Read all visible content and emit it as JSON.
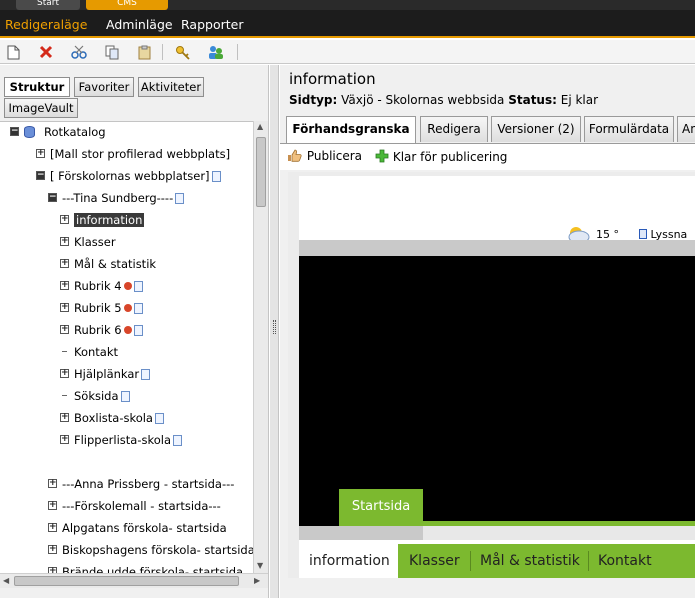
{
  "top_tabs": [
    "Start",
    "CMS"
  ],
  "modes": {
    "edit": "Redigeraläge",
    "admin": "Adminläge",
    "reports": "Rapporter"
  },
  "toolbar_icons": [
    "new-page-icon",
    "delete-icon",
    "cut-icon",
    "copy-icon",
    "paste-icon",
    "key-icon",
    "users-icon"
  ],
  "left_tabs": {
    "struktur": "Struktur",
    "favoriter": "Favoriter",
    "aktiviteter": "Aktiviteter",
    "imagevault": "ImageVault"
  },
  "tree": [
    {
      "label": "Rotkatalog",
      "level": 0,
      "state": "open",
      "icon": "database"
    },
    {
      "label": "[Mall stor profilerad webbplats]",
      "level": 1,
      "state": "closed"
    },
    {
      "label": "[ Förskolornas webbplatser]",
      "level": 1,
      "state": "open",
      "page": true
    },
    {
      "label": "---Tina Sundberg----",
      "level": 2,
      "state": "open",
      "page": true
    },
    {
      "label": "information",
      "level": 3,
      "state": "closed",
      "selected": true
    },
    {
      "label": "Klasser",
      "level": 3,
      "state": "closed"
    },
    {
      "label": "Mål & statistik",
      "level": 3,
      "state": "closed"
    },
    {
      "label": "Rubrik 4",
      "level": 3,
      "state": "closed",
      "lock": true,
      "page": true
    },
    {
      "label": "Rubrik 5",
      "level": 3,
      "state": "closed",
      "lock": true,
      "page": true
    },
    {
      "label": "Rubrik 6",
      "level": 3,
      "state": "closed",
      "lock": true,
      "page": true
    },
    {
      "label": "Kontakt",
      "level": 3,
      "state": "leaf"
    },
    {
      "label": "Hjälplänkar",
      "level": 3,
      "state": "closed",
      "page": true
    },
    {
      "label": "Söksida",
      "level": 3,
      "state": "leaf",
      "page": true
    },
    {
      "label": "Boxlista-skola",
      "level": 3,
      "state": "closed",
      "page": true
    },
    {
      "label": "Flipperlista-skola",
      "level": 3,
      "state": "closed",
      "page": true
    },
    {
      "label": "",
      "level": 2,
      "state": "spacer"
    },
    {
      "label": "---Anna Prissberg - startsida---",
      "level": 2,
      "state": "closed"
    },
    {
      "label": "---Förskolemall - startsida---",
      "level": 2,
      "state": "closed"
    },
    {
      "label": "Alpgatans förskola- startsida",
      "level": 2,
      "state": "closed"
    },
    {
      "label": "Biskopshagens förskola- startsida",
      "level": 2,
      "state": "closed"
    },
    {
      "label": "Brände udde förskola- startsida",
      "level": 2,
      "state": "closed"
    }
  ],
  "page": {
    "title": "information",
    "type_label": "Sidtyp:",
    "type_value": "Växjö - Skolornas webbsida",
    "status_label": "Status:",
    "status_value": "Ej klar"
  },
  "right_tabs": {
    "preview": "Förhandsgranska",
    "edit": "Redigera",
    "versions": "Versioner (2)",
    "forms": "Formulärdata",
    "more": "An"
  },
  "actions": {
    "publish": "Publicera",
    "ready": "Klar för publicering"
  },
  "preview": {
    "temperature": "15 °",
    "listen": "Lyssna",
    "start_tab": "Startsida",
    "nav": [
      "information",
      "Klasser",
      "Mål & statistik",
      "Kontakt"
    ]
  },
  "colors": {
    "accent_orange": "#e69a00",
    "site_green": "#7cb92f",
    "selected_node": "#3a3a3a"
  }
}
